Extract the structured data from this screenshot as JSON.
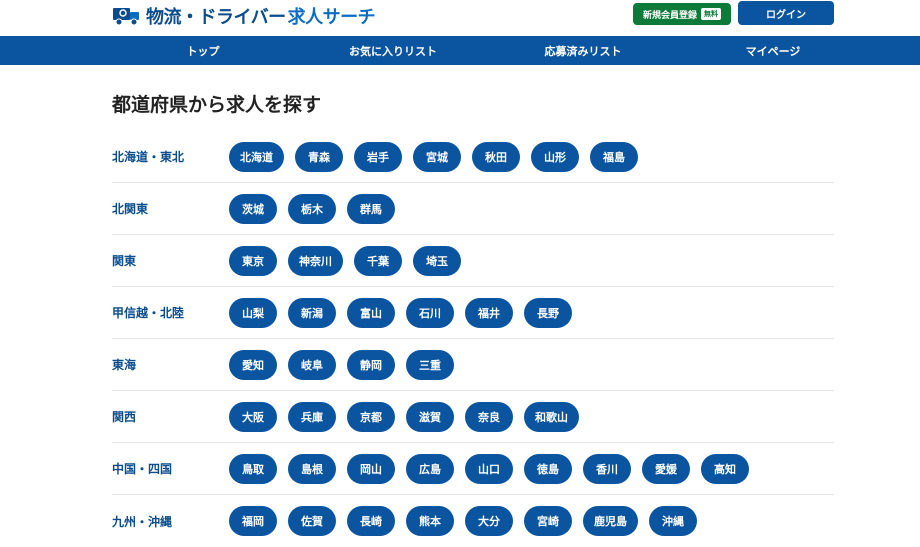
{
  "header": {
    "logo_name": "物流・ドライバー",
    "logo_sub": "求人サーチ",
    "register_label": "新規会員登録",
    "register_badge": "無料",
    "login_label": "ログイン"
  },
  "nav": [
    "トップ",
    "お気に入りリスト",
    "応募済みリスト",
    "マイページ"
  ],
  "page_title": "都道府県から求人を探す",
  "regions": [
    {
      "name": "北海道・東北",
      "prefs": [
        "北海道",
        "青森",
        "岩手",
        "宮城",
        "秋田",
        "山形",
        "福島"
      ]
    },
    {
      "name": "北関東",
      "prefs": [
        "茨城",
        "栃木",
        "群馬"
      ]
    },
    {
      "name": "関東",
      "prefs": [
        "東京",
        "神奈川",
        "千葉",
        "埼玉"
      ]
    },
    {
      "name": "甲信越・北陸",
      "prefs": [
        "山梨",
        "新潟",
        "富山",
        "石川",
        "福井",
        "長野"
      ]
    },
    {
      "name": "東海",
      "prefs": [
        "愛知",
        "岐阜",
        "静岡",
        "三重"
      ]
    },
    {
      "name": "関西",
      "prefs": [
        "大阪",
        "兵庫",
        "京都",
        "滋賀",
        "奈良",
        "和歌山"
      ]
    },
    {
      "name": "中国・四国",
      "prefs": [
        "鳥取",
        "島根",
        "岡山",
        "広島",
        "山口",
        "徳島",
        "香川",
        "愛媛",
        "高知"
      ]
    },
    {
      "name": "九州・沖縄",
      "prefs": [
        "福岡",
        "佐賀",
        "長崎",
        "熊本",
        "大分",
        "宮崎",
        "鹿児島",
        "沖縄"
      ]
    }
  ],
  "colors": {
    "primary": "#0b55a0",
    "register": "#0d7a3a",
    "region_text": "#0b4d8c"
  },
  "icons": {
    "logo": "truck-icon"
  }
}
